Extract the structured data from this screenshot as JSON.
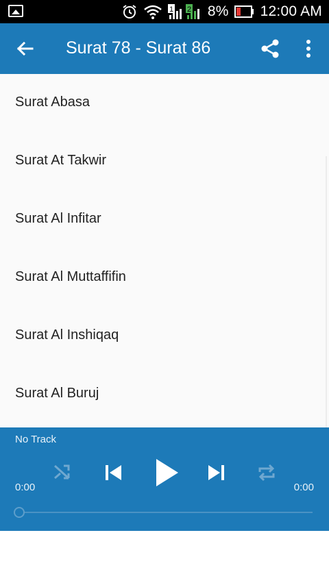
{
  "status_bar": {
    "battery": "8%",
    "time": "12:00 AM",
    "sim1": "1",
    "sim2": "2"
  },
  "app_bar": {
    "title": "Surat 78 - Surat 86"
  },
  "list": {
    "items": [
      {
        "label": "Surat Abasa"
      },
      {
        "label": "Surat At Takwir"
      },
      {
        "label": "Surat Al Infitar"
      },
      {
        "label": "Surat Al Muttaffifin"
      },
      {
        "label": "Surat Al Inshiqaq"
      },
      {
        "label": "Surat Al Buruj"
      }
    ]
  },
  "player": {
    "track": "No Track",
    "elapsed": "0:00",
    "duration": "0:00",
    "progress": 0
  },
  "colors": {
    "primary": "#1d7ab8",
    "battery_low": "#e53935",
    "sim2": "#4caf50"
  },
  "icons": [
    "notification-icon",
    "alarm-icon",
    "wifi-icon",
    "signal-icon",
    "battery-icon",
    "back-arrow-icon",
    "share-icon",
    "more-vert-icon",
    "shuffle-icon",
    "skip-previous-icon",
    "play-icon",
    "skip-next-icon",
    "repeat-icon"
  ]
}
